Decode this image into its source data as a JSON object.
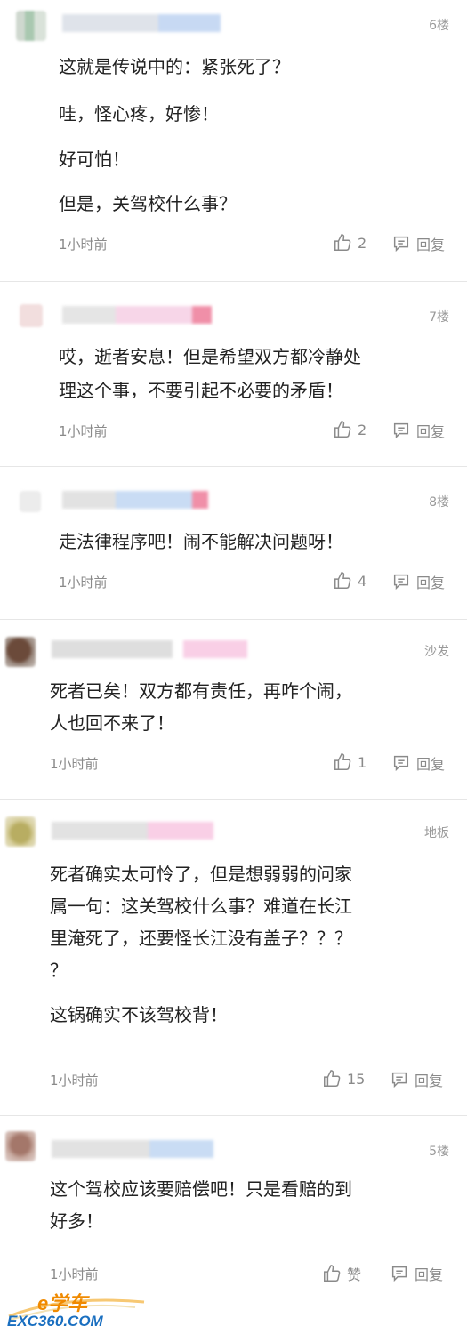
{
  "comments": [
    {
      "floor": "6楼",
      "paragraphs": [
        "这就是传说中的：紧张死了？",
        "哇，怪心疼，好惨！",
        "好可怕！",
        "但是，关驾校什么事？"
      ],
      "time": "1小时前",
      "likes": "2",
      "reply": "回复"
    },
    {
      "floor": "7楼",
      "paragraphs": [
        "哎，逝者安息！但是希望双方都冷静处",
        "理这个事，不要引起不必要的矛盾！"
      ],
      "time": "1小时前",
      "likes": "2",
      "reply": "回复"
    },
    {
      "floor": "8楼",
      "paragraphs": [
        "走法律程序吧！闹不能解决问题呀！"
      ],
      "time": "1小时前",
      "likes": "4",
      "reply": "回复"
    },
    {
      "floor": "沙发",
      "paragraphs": [
        "死者已矣！双方都有责任，再咋个闹，",
        "人也回不来了！"
      ],
      "time": "1小时前",
      "likes": "1",
      "reply": "回复"
    },
    {
      "floor": "地板",
      "paragraphs": [
        "死者确实太可怜了，但是想弱弱的问家",
        "属一句：这关驾校什么事？难道在长江",
        "里淹死了，还要怪长江没有盖子？？？",
        "？",
        "这锅确实不该驾校背！"
      ],
      "time": "1小时前",
      "likes": "15",
      "reply": "回复"
    },
    {
      "floor": "5楼",
      "paragraphs": [
        "这个驾校应该要赔偿吧！只是看赔的到",
        "好多！"
      ],
      "time": "1小时前",
      "likes": "赞",
      "reply": "回复"
    }
  ],
  "watermark": {
    "line1": "e学车",
    "line2": "EXC360.COM"
  },
  "colors": {
    "text": "#222222",
    "meta": "#8a8a8a",
    "divider": "#e6e6e6",
    "watermark_orange": "#f08a00",
    "watermark_blue": "#1a6fc0"
  },
  "icons": {
    "like": "thumbs-up-icon",
    "reply": "comment-icon"
  }
}
